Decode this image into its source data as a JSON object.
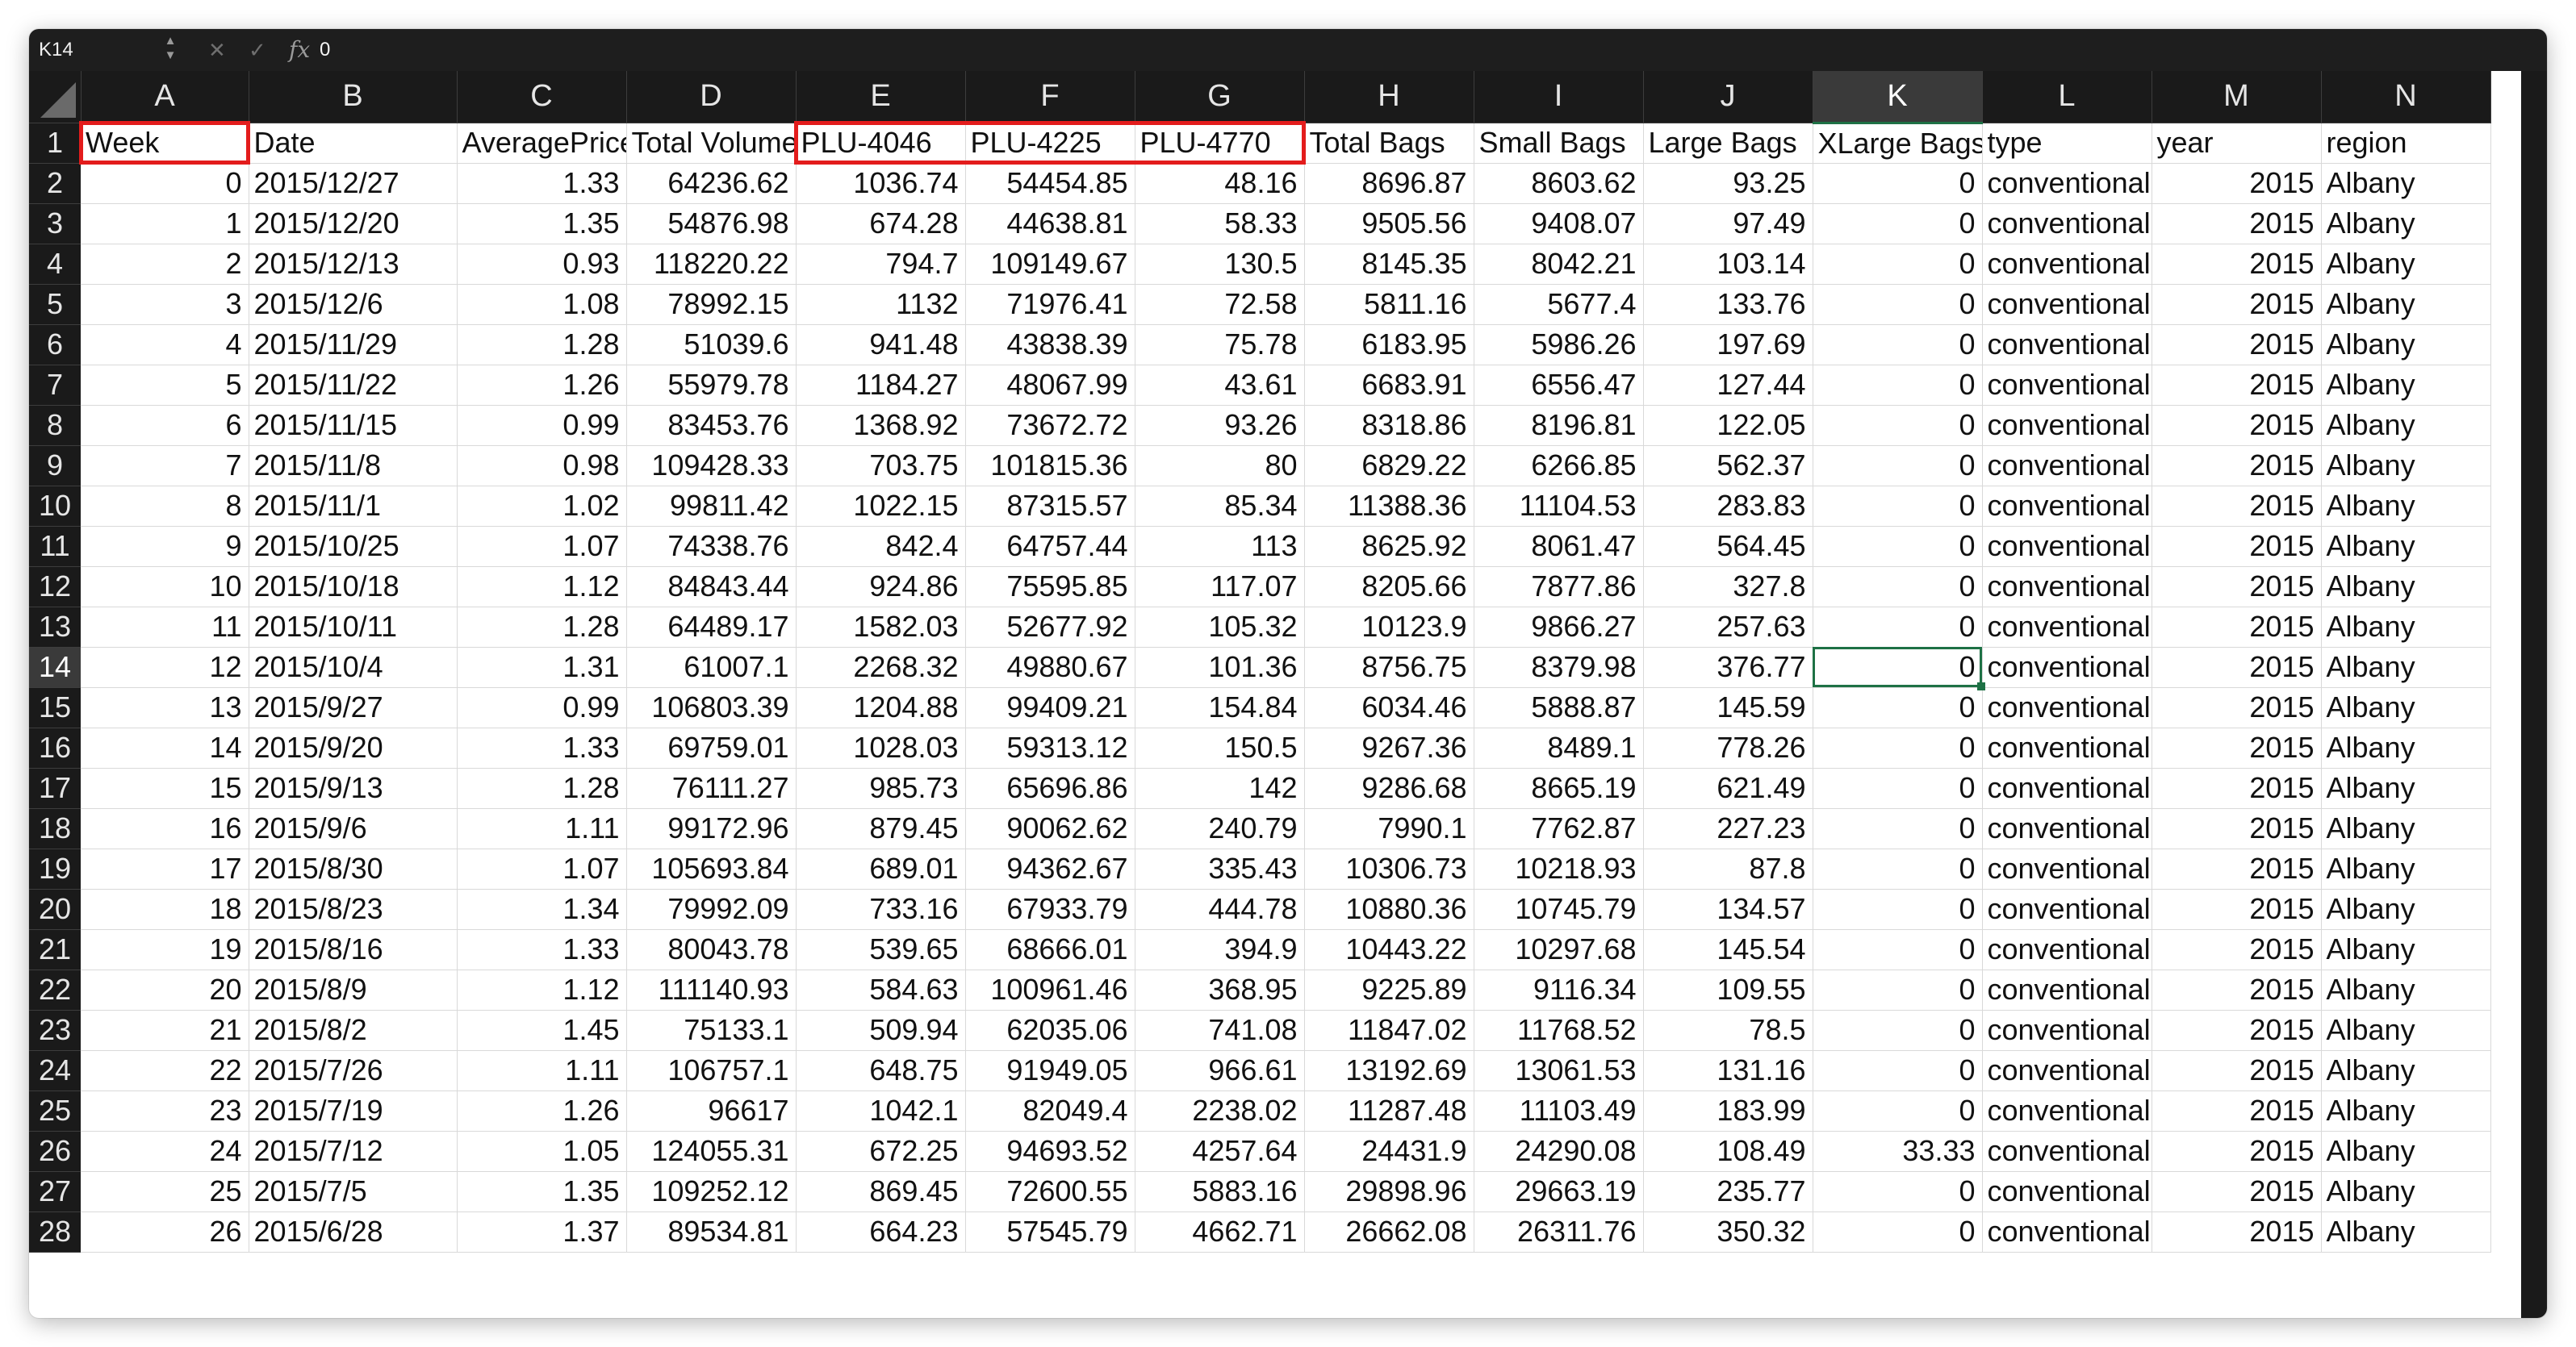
{
  "formula_bar": {
    "name_box": "K14",
    "formula_value": "0",
    "cancel_icon": "cancel-icon",
    "confirm_icon": "confirm-icon",
    "fx_label": "fx"
  },
  "columns": [
    "A",
    "B",
    "C",
    "D",
    "E",
    "F",
    "G",
    "H",
    "I",
    "J",
    "K",
    "L",
    "M",
    "N"
  ],
  "selected_column": "K",
  "selected_row": "14",
  "headers": [
    "Week",
    "Date",
    "AveragePrice",
    "Total Volume",
    "PLU-4046",
    "PLU-4225",
    "PLU-4770",
    "Total Bags",
    "Small Bags",
    "Large Bags",
    "XLarge Bags",
    "type",
    "year",
    "region"
  ],
  "rows": [
    [
      "0",
      "2015/12/27",
      "1.33",
      "64236.62",
      "1036.74",
      "54454.85",
      "48.16",
      "8696.87",
      "8603.62",
      "93.25",
      "0",
      "conventional",
      "2015",
      "Albany"
    ],
    [
      "1",
      "2015/12/20",
      "1.35",
      "54876.98",
      "674.28",
      "44638.81",
      "58.33",
      "9505.56",
      "9408.07",
      "97.49",
      "0",
      "conventional",
      "2015",
      "Albany"
    ],
    [
      "2",
      "2015/12/13",
      "0.93",
      "118220.22",
      "794.7",
      "109149.67",
      "130.5",
      "8145.35",
      "8042.21",
      "103.14",
      "0",
      "conventional",
      "2015",
      "Albany"
    ],
    [
      "3",
      "2015/12/6",
      "1.08",
      "78992.15",
      "1132",
      "71976.41",
      "72.58",
      "5811.16",
      "5677.4",
      "133.76",
      "0",
      "conventional",
      "2015",
      "Albany"
    ],
    [
      "4",
      "2015/11/29",
      "1.28",
      "51039.6",
      "941.48",
      "43838.39",
      "75.78",
      "6183.95",
      "5986.26",
      "197.69",
      "0",
      "conventional",
      "2015",
      "Albany"
    ],
    [
      "5",
      "2015/11/22",
      "1.26",
      "55979.78",
      "1184.27",
      "48067.99",
      "43.61",
      "6683.91",
      "6556.47",
      "127.44",
      "0",
      "conventional",
      "2015",
      "Albany"
    ],
    [
      "6",
      "2015/11/15",
      "0.99",
      "83453.76",
      "1368.92",
      "73672.72",
      "93.26",
      "8318.86",
      "8196.81",
      "122.05",
      "0",
      "conventional",
      "2015",
      "Albany"
    ],
    [
      "7",
      "2015/11/8",
      "0.98",
      "109428.33",
      "703.75",
      "101815.36",
      "80",
      "6829.22",
      "6266.85",
      "562.37",
      "0",
      "conventional",
      "2015",
      "Albany"
    ],
    [
      "8",
      "2015/11/1",
      "1.02",
      "99811.42",
      "1022.15",
      "87315.57",
      "85.34",
      "11388.36",
      "11104.53",
      "283.83",
      "0",
      "conventional",
      "2015",
      "Albany"
    ],
    [
      "9",
      "2015/10/25",
      "1.07",
      "74338.76",
      "842.4",
      "64757.44",
      "113",
      "8625.92",
      "8061.47",
      "564.45",
      "0",
      "conventional",
      "2015",
      "Albany"
    ],
    [
      "10",
      "2015/10/18",
      "1.12",
      "84843.44",
      "924.86",
      "75595.85",
      "117.07",
      "8205.66",
      "7877.86",
      "327.8",
      "0",
      "conventional",
      "2015",
      "Albany"
    ],
    [
      "11",
      "2015/10/11",
      "1.28",
      "64489.17",
      "1582.03",
      "52677.92",
      "105.32",
      "10123.9",
      "9866.27",
      "257.63",
      "0",
      "conventional",
      "2015",
      "Albany"
    ],
    [
      "12",
      "2015/10/4",
      "1.31",
      "61007.1",
      "2268.32",
      "49880.67",
      "101.36",
      "8756.75",
      "8379.98",
      "376.77",
      "0",
      "conventional",
      "2015",
      "Albany"
    ],
    [
      "13",
      "2015/9/27",
      "0.99",
      "106803.39",
      "1204.88",
      "99409.21",
      "154.84",
      "6034.46",
      "5888.87",
      "145.59",
      "0",
      "conventional",
      "2015",
      "Albany"
    ],
    [
      "14",
      "2015/9/20",
      "1.33",
      "69759.01",
      "1028.03",
      "59313.12",
      "150.5",
      "9267.36",
      "8489.1",
      "778.26",
      "0",
      "conventional",
      "2015",
      "Albany"
    ],
    [
      "15",
      "2015/9/13",
      "1.28",
      "76111.27",
      "985.73",
      "65696.86",
      "142",
      "9286.68",
      "8665.19",
      "621.49",
      "0",
      "conventional",
      "2015",
      "Albany"
    ],
    [
      "16",
      "2015/9/6",
      "1.11",
      "99172.96",
      "879.45",
      "90062.62",
      "240.79",
      "7990.1",
      "7762.87",
      "227.23",
      "0",
      "conventional",
      "2015",
      "Albany"
    ],
    [
      "17",
      "2015/8/30",
      "1.07",
      "105693.84",
      "689.01",
      "94362.67",
      "335.43",
      "10306.73",
      "10218.93",
      "87.8",
      "0",
      "conventional",
      "2015",
      "Albany"
    ],
    [
      "18",
      "2015/8/23",
      "1.34",
      "79992.09",
      "733.16",
      "67933.79",
      "444.78",
      "10880.36",
      "10745.79",
      "134.57",
      "0",
      "conventional",
      "2015",
      "Albany"
    ],
    [
      "19",
      "2015/8/16",
      "1.33",
      "80043.78",
      "539.65",
      "68666.01",
      "394.9",
      "10443.22",
      "10297.68",
      "145.54",
      "0",
      "conventional",
      "2015",
      "Albany"
    ],
    [
      "20",
      "2015/8/9",
      "1.12",
      "111140.93",
      "584.63",
      "100961.46",
      "368.95",
      "9225.89",
      "9116.34",
      "109.55",
      "0",
      "conventional",
      "2015",
      "Albany"
    ],
    [
      "21",
      "2015/8/2",
      "1.45",
      "75133.1",
      "509.94",
      "62035.06",
      "741.08",
      "11847.02",
      "11768.52",
      "78.5",
      "0",
      "conventional",
      "2015",
      "Albany"
    ],
    [
      "22",
      "2015/7/26",
      "1.11",
      "106757.1",
      "648.75",
      "91949.05",
      "966.61",
      "13192.69",
      "13061.53",
      "131.16",
      "0",
      "conventional",
      "2015",
      "Albany"
    ],
    [
      "23",
      "2015/7/19",
      "1.26",
      "96617",
      "1042.1",
      "82049.4",
      "2238.02",
      "11287.48",
      "11103.49",
      "183.99",
      "0",
      "conventional",
      "2015",
      "Albany"
    ],
    [
      "24",
      "2015/7/12",
      "1.05",
      "124055.31",
      "672.25",
      "94693.52",
      "4257.64",
      "24431.9",
      "24290.08",
      "108.49",
      "33.33",
      "conventional",
      "2015",
      "Albany"
    ],
    [
      "25",
      "2015/7/5",
      "1.35",
      "109252.12",
      "869.45",
      "72600.55",
      "5883.16",
      "29898.96",
      "29663.19",
      "235.77",
      "0",
      "conventional",
      "2015",
      "Albany"
    ],
    [
      "26",
      "2015/6/28",
      "1.37",
      "89534.81",
      "664.23",
      "57545.79",
      "4662.71",
      "26662.08",
      "26311.76",
      "350.32",
      "0",
      "conventional",
      "2015",
      "Albany"
    ]
  ],
  "colors": {
    "header_bg": "#1a1a1a",
    "selection_green": "#1e7145",
    "highlight_red": "#e31c1c"
  }
}
